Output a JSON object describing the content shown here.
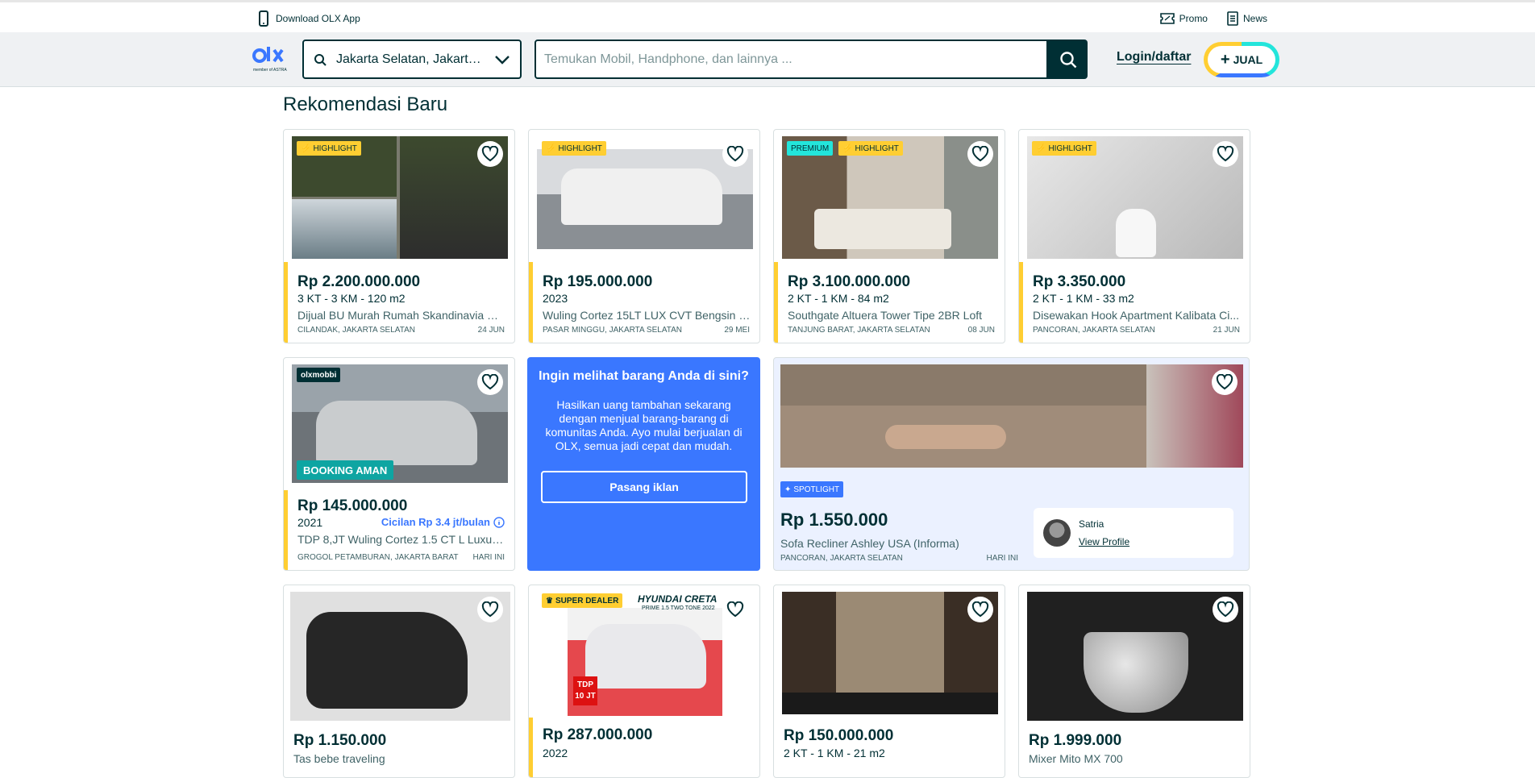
{
  "topbar": {
    "download_app": "Download OLX App",
    "promo": "Promo",
    "news": "News"
  },
  "header": {
    "logo_text": "OLX",
    "logo_sub": "member of ASTRA",
    "location": "Jakarta Selatan, Jakarta...",
    "search_placeholder": "Temukan Mobil, Handphone, dan lainnya ...",
    "login": "Login/daftar",
    "sell": "JUAL"
  },
  "section_title": "Rekomendasi Baru",
  "cards_row1": [
    {
      "badges": [
        "HIGHLIGHT"
      ],
      "price": "Rp 2.200.000.000",
      "sub": "3 KT - 3 KM - 120 m2",
      "title": "Dijual BU Murah Rumah Skandinavia Ci...",
      "location": "CILANDAK, JAKARTA SELATAN",
      "date": "24 JUN"
    },
    {
      "badges": [
        "HIGHLIGHT"
      ],
      "price": "Rp 195.000.000",
      "sub": "2023",
      "title": "Wuling Cortez 15LT LUX CVT Bengsin R...",
      "location": "PASAR MINGGU, JAKARTA SELATAN",
      "date": "29 MEI"
    },
    {
      "badges": [
        "PREMIUM",
        "HIGHLIGHT"
      ],
      "price": "Rp 3.100.000.000",
      "sub": "2 KT - 1 KM - 84 m2",
      "title": "Southgate Altuera Tower Tipe 2BR Loft",
      "location": "TANJUNG BARAT, JAKARTA SELATAN",
      "date": "08 JUN"
    },
    {
      "badges": [
        "HIGHLIGHT"
      ],
      "price": "Rp 3.350.000",
      "sub": "2 KT - 1 KM - 33 m2",
      "title": "Disewakan Hook Apartment Kalibata Ci...",
      "location": "PANCORAN, JAKARTA SELATAN",
      "date": "21 JUN"
    }
  ],
  "card_row2": {
    "brand": "olxmobbi",
    "booking": "BOOKING AMAN",
    "price": "Rp 145.000.000",
    "sub": "2021",
    "installment": "Cicilan Rp 3.4 jt/bulan",
    "title": "TDP 8,JT Wuling Cortez 1.5 CT L Luxury...",
    "location": "GROGOL PETAMBURAN, JAKARTA BARAT",
    "date": "HARI INI"
  },
  "promo": {
    "title": "Ingin melihat barang Anda di sini?",
    "body": "Hasilkan uang tambahan sekarang dengan menjual barang-barang di komunitas Anda. Ayo mulai berjualan di OLX, semua jadi cepat dan mudah.",
    "button": "Pasang iklan"
  },
  "spotlight": {
    "badge": "SPOTLIGHT",
    "price": "Rp 1.550.000",
    "title": "Sofa Recliner Ashley USA (Informa)",
    "location": "PANCORAN, JAKARTA SELATAN",
    "date": "HARI INI",
    "seller": "Satria",
    "view_profile": "View Profile"
  },
  "cards_row3": [
    {
      "price": "Rp 1.150.000",
      "sub": "Tas bebe traveling"
    },
    {
      "badge": "SUPER DEALER",
      "ad_title": "HYUNDAI CRETA",
      "ad_sub": "PRIME 1.5 TWO TONE 2022",
      "tdp": "TDP",
      "tdp_val": "10 JT",
      "price": "Rp 287.000.000",
      "sub": "2022"
    },
    {
      "price": "Rp 150.000.000",
      "sub": "2 KT - 1 KM - 21 m2"
    },
    {
      "price": "Rp 1.999.000",
      "sub": "Mixer Mito MX 700"
    }
  ],
  "colors": {
    "primary": "#002f34",
    "highlight": "#ffce32",
    "premium": "#23e5db",
    "blue": "#3a77ff"
  }
}
